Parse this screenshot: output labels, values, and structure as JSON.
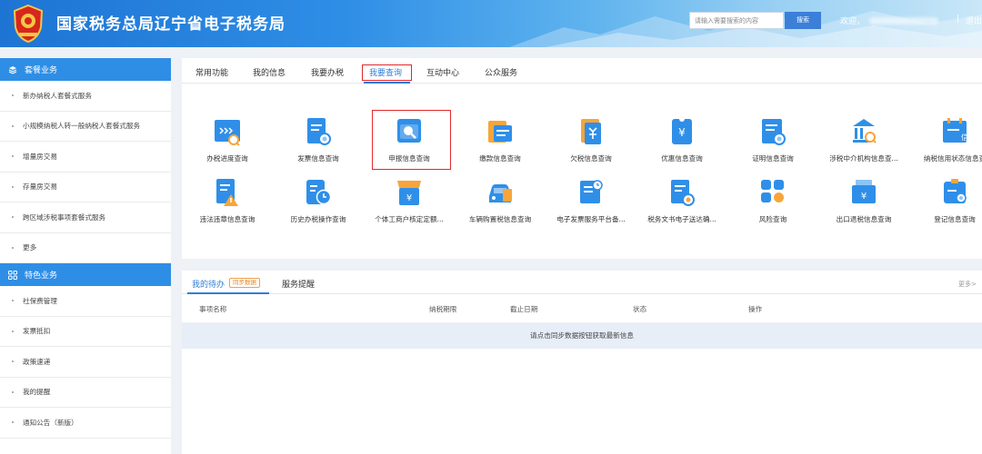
{
  "header": {
    "title": "国家税务总局辽宁省电子税务局",
    "search_placeholder": "请输入需要搜索的内容",
    "search_button": "搜索",
    "welcome": "欢迎，",
    "divider": "|",
    "logout": "退出"
  },
  "sidebar": {
    "section1_title": "套餐业务",
    "section1_items": [
      "新办纳税人套餐式服务",
      "小规模纳税人转一般纳税人套餐式服务",
      "增量房交易",
      "存量房交易",
      "跨区域涉税事项套餐式服务",
      "更多"
    ],
    "section2_title": "特色业务",
    "section2_items": [
      "社保费管理",
      "发票抵扣",
      "政策速递",
      "我的提醒",
      "通知公告（新版）"
    ]
  },
  "tabs": [
    "常用功能",
    "我的信息",
    "我要办税",
    "我要查询",
    "互动中心",
    "公众服务"
  ],
  "active_tab": "我要查询",
  "services_row1": [
    {
      "label": "办税进度查询",
      "icon": "progress-query-icon"
    },
    {
      "label": "发票信息查询",
      "icon": "invoice-query-icon"
    },
    {
      "label": "申报信息查询",
      "icon": "declaration-query-icon"
    },
    {
      "label": "缴款信息查询",
      "icon": "payment-query-icon"
    },
    {
      "label": "欠税信息查询",
      "icon": "arrears-query-icon"
    },
    {
      "label": "优惠信息查询",
      "icon": "preferential-query-icon"
    },
    {
      "label": "证明信息查询",
      "icon": "certificate-query-icon"
    },
    {
      "label": "涉税中介机构信息查...",
      "icon": "agency-query-icon"
    },
    {
      "label": "纳税信用状态信息查",
      "icon": "credit-query-icon"
    }
  ],
  "services_row2": [
    {
      "label": "违法违章信息查询",
      "icon": "violation-query-icon"
    },
    {
      "label": "历史办税操作查询",
      "icon": "history-query-icon"
    },
    {
      "label": "个体工商户核定定额...",
      "icon": "individual-business-icon"
    },
    {
      "label": "车辆购置税信息查询",
      "icon": "vehicle-tax-icon"
    },
    {
      "label": "电子发票服务平台备...",
      "icon": "einvoice-platform-icon"
    },
    {
      "label": "税务文书电子送达确...",
      "icon": "tax-document-icon"
    },
    {
      "label": "风险查询",
      "icon": "risk-query-icon"
    },
    {
      "label": "出口退税信息查询",
      "icon": "export-rebate-icon"
    },
    {
      "label": "登记信息查询",
      "icon": "registration-query-icon"
    }
  ],
  "todo": {
    "tab1": "我的待办",
    "sync_badge": "同步数据",
    "tab2": "服务提醒",
    "more": "更多>",
    "columns": [
      "事项名称",
      "纳税期限",
      "截止日期",
      "状态",
      "操作"
    ],
    "empty_message": "请点击同步数据按钮获取最新信息"
  },
  "colors": {
    "primary": "#2e8ee6",
    "highlight": "#e0282c",
    "icon_blue": "#2f8fe8",
    "icon_orange": "#f7a53a"
  }
}
